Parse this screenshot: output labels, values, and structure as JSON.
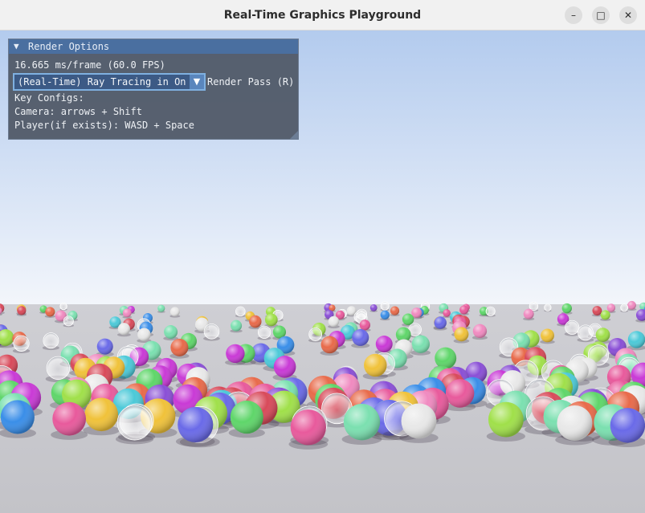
{
  "window": {
    "title": "Real-Time Graphics Playground",
    "buttons": {
      "minimize": "–",
      "maximize": "□",
      "close": "✕"
    }
  },
  "panel": {
    "header": "Render Options",
    "header_arrow": "▼",
    "frame_stats": "16.665 ms/frame (60.0 FPS)",
    "render_pass_value": "(Real-Time) Ray Tracing in One",
    "render_pass_label": "Render Pass (R)",
    "combo_arrow": "▼",
    "key_configs_title": "Key Configs:",
    "camera_keys": "Camera: arrows + Shift",
    "player_keys": "Player(if exists): WASD + Space"
  }
}
